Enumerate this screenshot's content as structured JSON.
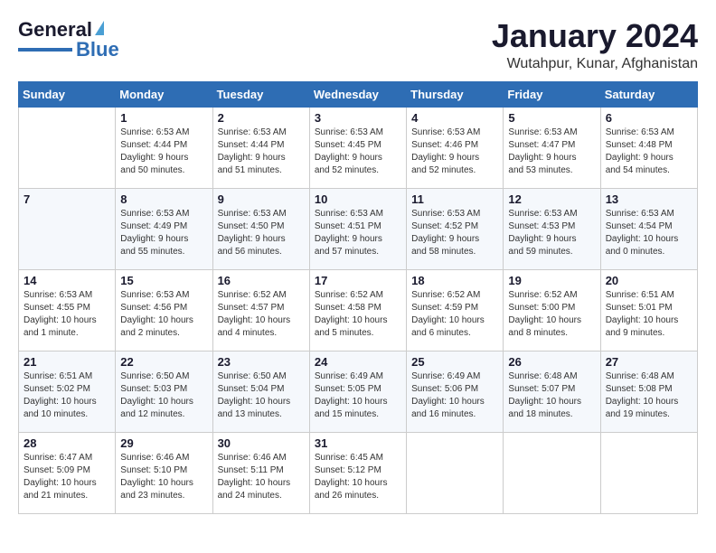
{
  "header": {
    "logo_line1": "General",
    "logo_line2": "Blue",
    "month_title": "January 2024",
    "location": "Wutahpur, Kunar, Afghanistan"
  },
  "days_of_week": [
    "Sunday",
    "Monday",
    "Tuesday",
    "Wednesday",
    "Thursday",
    "Friday",
    "Saturday"
  ],
  "weeks": [
    [
      {
        "day": "",
        "info": ""
      },
      {
        "day": "1",
        "info": "Sunrise: 6:53 AM\nSunset: 4:44 PM\nDaylight: 9 hours\nand 50 minutes."
      },
      {
        "day": "2",
        "info": "Sunrise: 6:53 AM\nSunset: 4:44 PM\nDaylight: 9 hours\nand 51 minutes."
      },
      {
        "day": "3",
        "info": "Sunrise: 6:53 AM\nSunset: 4:45 PM\nDaylight: 9 hours\nand 52 minutes."
      },
      {
        "day": "4",
        "info": "Sunrise: 6:53 AM\nSunset: 4:46 PM\nDaylight: 9 hours\nand 52 minutes."
      },
      {
        "day": "5",
        "info": "Sunrise: 6:53 AM\nSunset: 4:47 PM\nDaylight: 9 hours\nand 53 minutes."
      },
      {
        "day": "6",
        "info": "Sunrise: 6:53 AM\nSunset: 4:48 PM\nDaylight: 9 hours\nand 54 minutes."
      }
    ],
    [
      {
        "day": "7",
        "info": ""
      },
      {
        "day": "8",
        "info": "Sunrise: 6:53 AM\nSunset: 4:49 PM\nDaylight: 9 hours\nand 55 minutes."
      },
      {
        "day": "9",
        "info": "Sunrise: 6:53 AM\nSunset: 4:50 PM\nDaylight: 9 hours\nand 56 minutes."
      },
      {
        "day": "10",
        "info": "Sunrise: 6:53 AM\nSunset: 4:51 PM\nDaylight: 9 hours\nand 57 minutes."
      },
      {
        "day": "11",
        "info": "Sunrise: 6:53 AM\nSunset: 4:52 PM\nDaylight: 9 hours\nand 58 minutes."
      },
      {
        "day": "12",
        "info": "Sunrise: 6:53 AM\nSunset: 4:53 PM\nDaylight: 9 hours\nand 59 minutes."
      },
      {
        "day": "13",
        "info": "Sunrise: 6:53 AM\nSunset: 4:54 PM\nDaylight: 10 hours\nand 0 minutes."
      }
    ],
    [
      {
        "day": "14",
        "info": "Sunrise: 6:53 AM\nSunset: 4:55 PM\nDaylight: 10 hours\nand 1 minute."
      },
      {
        "day": "15",
        "info": "Sunrise: 6:53 AM\nSunset: 4:56 PM\nDaylight: 10 hours\nand 2 minutes."
      },
      {
        "day": "16",
        "info": "Sunrise: 6:52 AM\nSunset: 4:57 PM\nDaylight: 10 hours\nand 4 minutes."
      },
      {
        "day": "17",
        "info": "Sunrise: 6:52 AM\nSunset: 4:58 PM\nDaylight: 10 hours\nand 5 minutes."
      },
      {
        "day": "18",
        "info": "Sunrise: 6:52 AM\nSunset: 4:59 PM\nDaylight: 10 hours\nand 6 minutes."
      },
      {
        "day": "19",
        "info": "Sunrise: 6:52 AM\nSunset: 5:00 PM\nDaylight: 10 hours\nand 8 minutes."
      },
      {
        "day": "20",
        "info": "Sunrise: 6:51 AM\nSunset: 5:01 PM\nDaylight: 10 hours\nand 9 minutes."
      }
    ],
    [
      {
        "day": "21",
        "info": "Sunrise: 6:51 AM\nSunset: 5:02 PM\nDaylight: 10 hours\nand 10 minutes."
      },
      {
        "day": "22",
        "info": "Sunrise: 6:50 AM\nSunset: 5:03 PM\nDaylight: 10 hours\nand 12 minutes."
      },
      {
        "day": "23",
        "info": "Sunrise: 6:50 AM\nSunset: 5:04 PM\nDaylight: 10 hours\nand 13 minutes."
      },
      {
        "day": "24",
        "info": "Sunrise: 6:49 AM\nSunset: 5:05 PM\nDaylight: 10 hours\nand 15 minutes."
      },
      {
        "day": "25",
        "info": "Sunrise: 6:49 AM\nSunset: 5:06 PM\nDaylight: 10 hours\nand 16 minutes."
      },
      {
        "day": "26",
        "info": "Sunrise: 6:48 AM\nSunset: 5:07 PM\nDaylight: 10 hours\nand 18 minutes."
      },
      {
        "day": "27",
        "info": "Sunrise: 6:48 AM\nSunset: 5:08 PM\nDaylight: 10 hours\nand 19 minutes."
      }
    ],
    [
      {
        "day": "28",
        "info": "Sunrise: 6:47 AM\nSunset: 5:09 PM\nDaylight: 10 hours\nand 21 minutes."
      },
      {
        "day": "29",
        "info": "Sunrise: 6:46 AM\nSunset: 5:10 PM\nDaylight: 10 hours\nand 23 minutes."
      },
      {
        "day": "30",
        "info": "Sunrise: 6:46 AM\nSunset: 5:11 PM\nDaylight: 10 hours\nand 24 minutes."
      },
      {
        "day": "31",
        "info": "Sunrise: 6:45 AM\nSunset: 5:12 PM\nDaylight: 10 hours\nand 26 minutes."
      },
      {
        "day": "",
        "info": ""
      },
      {
        "day": "",
        "info": ""
      },
      {
        "day": "",
        "info": ""
      }
    ]
  ]
}
